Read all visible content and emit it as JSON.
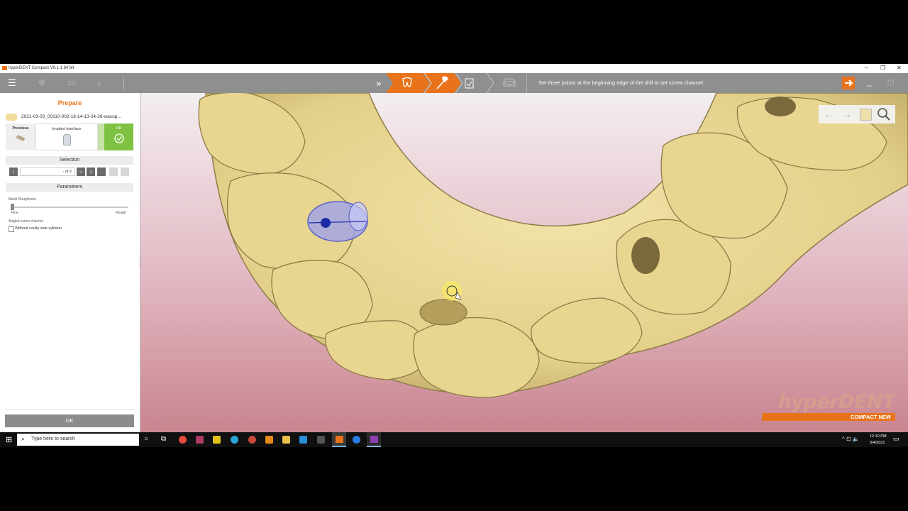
{
  "window": {
    "title": "hyperDENT Compact V9.1.1 64 bit"
  },
  "instruction": "Set three points at the beginning edge of the drill to set screw channel.",
  "sidebar": {
    "title": "Prepare",
    "file_name": "2021-03-03_00110-002-16-14-13-24-26-waxup...",
    "previous_label": "Previous",
    "current_label": "Implant interface",
    "ok_label": "OK",
    "selection_label": "Selection",
    "selection_value": "- of 2",
    "parameters_label": "Parameters",
    "mesh_roughness_label": "Mesh Roughness",
    "fine_label": "Fine",
    "rough_label": "Rough",
    "mesh_roughness_value": 0.0,
    "angled_label": "Angled screw channel",
    "checkbox_label": "Without cavity side cylinder",
    "checkbox_checked": false,
    "bottom_ok": "OK"
  },
  "viewport": {
    "coords": "13.0 | 34.8 | 36.7",
    "brand": "hyperDENT",
    "brand_sub": "COMPACT NEW"
  },
  "taskbar": {
    "search_placeholder": "Type here to search",
    "time": "12:10 PM",
    "date": "3/4/2021"
  },
  "colors": {
    "accent": "#e8731a",
    "ok_green": "#7fc242",
    "toolbar": "#8f8f8f"
  }
}
